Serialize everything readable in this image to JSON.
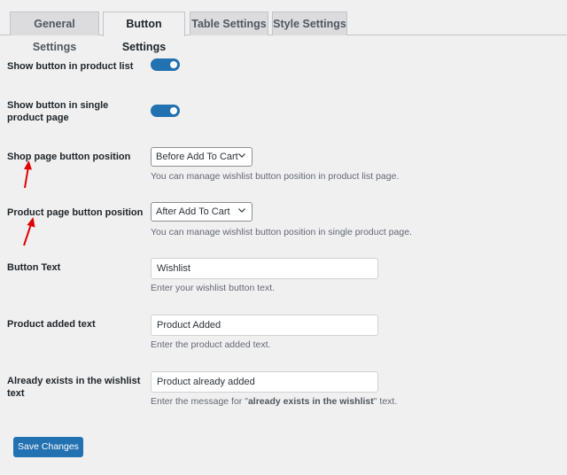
{
  "tabs": [
    {
      "label": "General Settings",
      "active": false
    },
    {
      "label": "Button Settings",
      "active": true
    },
    {
      "label": "Table Settings",
      "active": false
    },
    {
      "label": "Style Settings",
      "active": false
    }
  ],
  "settings": {
    "show_in_list": {
      "label": "Show button in product list",
      "enabled": true
    },
    "show_in_single": {
      "label_line1": "Show button in single",
      "label_line2": "product page",
      "enabled": true
    },
    "shop_position": {
      "label": "Shop page button position",
      "selected": "Before Add To Cart",
      "description": "You can manage wishlist button position in product list page."
    },
    "product_position": {
      "label": "Product page button position",
      "selected": "After Add To Cart",
      "description": "You can manage wishlist button position in single product page."
    },
    "button_text": {
      "label": "Button Text",
      "value": "Wishlist",
      "description": "Enter your wishlist button text."
    },
    "added_text": {
      "label": "Product added text",
      "value": "Product Added",
      "description": "Enter the product added text."
    },
    "exists_text": {
      "label_line1": "Already exists in the wishlist",
      "label_line2": "text",
      "value": "Product already added",
      "description_before": "Enter the message for \"",
      "description_bold": "already exists in the wishlist",
      "description_after": "\" text."
    }
  },
  "save_label": "Save Changes",
  "colors": {
    "accent": "#2271b1",
    "toggle_on": "#2271b1",
    "annotation_arrow": "#e00000",
    "background": "#f0f0f1"
  },
  "icons": {
    "select_chevron": "chevron-down-icon",
    "annotation": "red-arrow-icon"
  }
}
